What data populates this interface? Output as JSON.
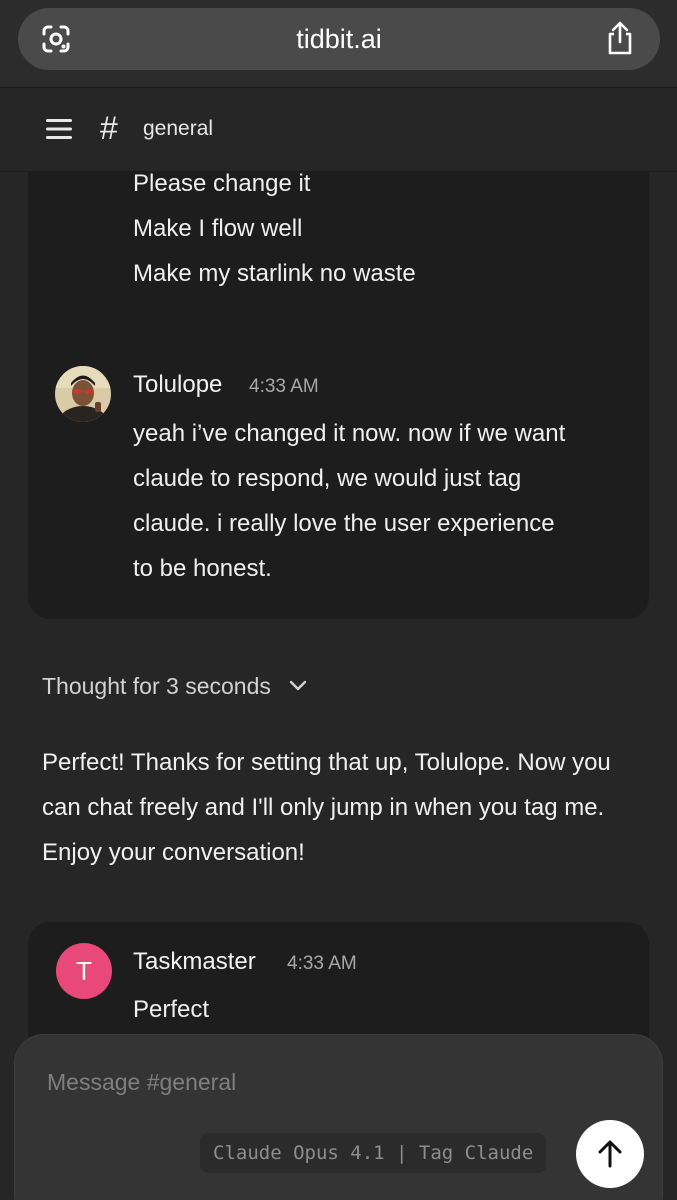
{
  "browser": {
    "url": "tidbit.ai"
  },
  "header": {
    "channel": "general",
    "hash_symbol": "#"
  },
  "messages": {
    "previous_lines": [
      "Please change it",
      "Make I flow well",
      "Make my starlink no waste"
    ],
    "tolulope": {
      "sender": "Tolulope",
      "time": "4:33 AM",
      "lines": [
        "yeah i’ve changed it now. now if we want",
        "claude to respond, we would just tag",
        "claude. i really love the user experience",
        "to be honest."
      ]
    },
    "thought": {
      "label": "Thought for 3 seconds"
    },
    "ai_reply": {
      "text": "Perfect! Thanks for setting that up, Tolulope. Now you can chat freely and I'll only jump in when you tag me. Enjoy your conversation!"
    },
    "taskmaster": {
      "sender": "Taskmaster",
      "avatar_letter": "T",
      "time": "4:33 AM",
      "text": "Perfect"
    }
  },
  "composer": {
    "placeholder": "Message #general",
    "model_chip": "Claude Opus 4.1 | Tag Claude"
  },
  "colors": {
    "background": "#262626",
    "card": "#1d1d1d",
    "taskmaster_avatar": "#e8487a",
    "send_button": "#ffffff"
  },
  "icons": [
    "google-lens-icon",
    "share-icon",
    "menu-icon",
    "chevron-down-icon",
    "arrow-up-icon"
  ]
}
